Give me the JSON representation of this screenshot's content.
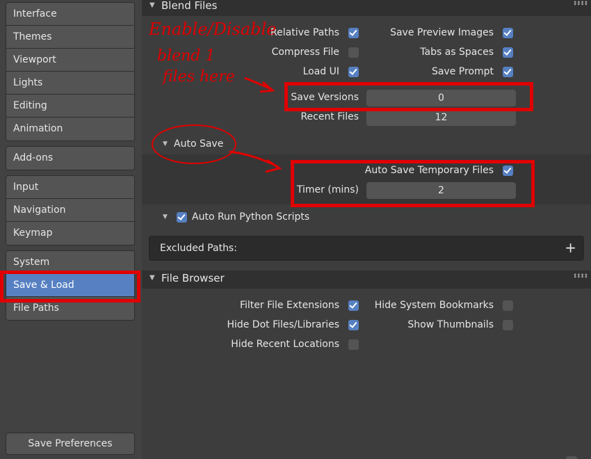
{
  "sidebar": {
    "groups": [
      [
        "Interface",
        "Themes",
        "Viewport",
        "Lights",
        "Editing",
        "Animation"
      ],
      [
        "Add-ons"
      ],
      [
        "Input",
        "Navigation",
        "Keymap"
      ],
      [
        "System",
        "Save & Load",
        "File Paths"
      ]
    ],
    "active": "Save & Load",
    "save_button": "Save Preferences"
  },
  "blend_files": {
    "title": "Blend Files",
    "relative_paths": {
      "label": "Relative Paths",
      "checked": true
    },
    "compress_file": {
      "label": "Compress File",
      "checked": false
    },
    "load_ui": {
      "label": "Load UI",
      "checked": true
    },
    "save_preview_images": {
      "label": "Save Preview Images",
      "checked": true
    },
    "tabs_as_spaces": {
      "label": "Tabs as Spaces",
      "checked": true
    },
    "save_prompt": {
      "label": "Save Prompt",
      "checked": true
    },
    "save_versions": {
      "label": "Save Versions",
      "value": "0"
    },
    "recent_files": {
      "label": "Recent Files",
      "value": "12"
    }
  },
  "auto_save": {
    "title": "Auto Save",
    "temp_files": {
      "label": "Auto Save Temporary Files",
      "checked": true
    },
    "timer": {
      "label": "Timer (mins)",
      "value": "2"
    }
  },
  "auto_run": {
    "label": "Auto Run Python Scripts",
    "checked": true
  },
  "excluded_paths": {
    "label": "Excluded Paths:",
    "add_icon": "plus-icon"
  },
  "file_browser": {
    "title": "File Browser",
    "filter_file_extensions": {
      "label": "Filter File Extensions",
      "checked": true
    },
    "hide_dot_files": {
      "label": "Hide Dot Files/Libraries",
      "checked": true
    },
    "hide_recent_locations": {
      "label": "Hide Recent Locations",
      "checked": false
    },
    "hide_system_bookmarks": {
      "label": "Hide System Bookmarks",
      "checked": false
    },
    "show_thumbnails": {
      "label": "Show Thumbnails",
      "checked": false
    }
  },
  "annotations": {
    "line1": "Enable/Disable",
    "line2": "blend 1",
    "line3": "files here"
  },
  "colors": {
    "accent": "#5680c2",
    "annotation_red": "#e00000"
  }
}
